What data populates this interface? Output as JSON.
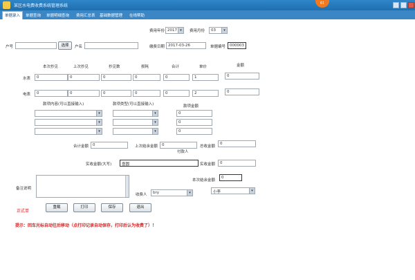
{
  "window": {
    "title": "某区水电费收费系统管理系统",
    "badge": "61"
  },
  "tabs": [
    "单据录入",
    "单据查询",
    "单据明细查询",
    "费用汇总表",
    "基础数据管理",
    "在线帮助"
  ],
  "header": {
    "fee_year_label": "费用年份",
    "fee_year_value": "2017",
    "fee_month_label": "费用月份",
    "fee_month_value": "03",
    "account_label": "户号",
    "account_value": "",
    "select_button": "选择",
    "name_label": "户名",
    "name_value": "",
    "date_label": "缴费日期",
    "date_value": "2017-03-26",
    "doc_no_label": "单据编号",
    "doc_no_value": "000003"
  },
  "meter": {
    "columns": [
      "本次抄见",
      "上次抄见",
      "抄见数",
      "损耗",
      "合计",
      "单价",
      "金额"
    ],
    "rows": [
      {
        "label": "水表",
        "values": [
          "0",
          "0",
          "0",
          "0",
          "0",
          "1",
          "0"
        ]
      },
      {
        "label": "电表",
        "values": [
          "0",
          "0",
          "0",
          "0",
          "0",
          "2",
          "0"
        ]
      }
    ]
  },
  "fees": {
    "item_label": "款项内容(可以直接输入)",
    "type_label": "款项类型(可以直接输入)",
    "amount_label": "款项金额",
    "amounts": [
      "0",
      "0",
      "0"
    ]
  },
  "totals": {
    "subtotal_label": "合计金额",
    "subtotal_value": "0",
    "last_balance_label": "上次结余金额",
    "last_balance_value": "0",
    "total_label": "总收金额",
    "total_value": "0",
    "payer_label": "付款人",
    "received_upper_label": "实收金额(大写)",
    "received_upper_value": "壹圆",
    "received_label": "实收金额",
    "received_value": "0",
    "balance_label": "本次结余金额",
    "balance_value": "0"
  },
  "remarks": {
    "label": "备注说明",
    "value": ""
  },
  "collector": {
    "label": "收费人",
    "value": "bry",
    "unit_value": "小李"
  },
  "actions": {
    "status": "正式单",
    "reload": "重载",
    "print": "打印",
    "save": "保存",
    "exit": "退出"
  },
  "tip": "提示：回车光标自动往后移动（点打印记录自动保存，打印后认为收费了）！",
  "colors": {
    "titlebar": "#2f86c8",
    "tabbar": "#3b86c4",
    "warning": "#e02020"
  }
}
